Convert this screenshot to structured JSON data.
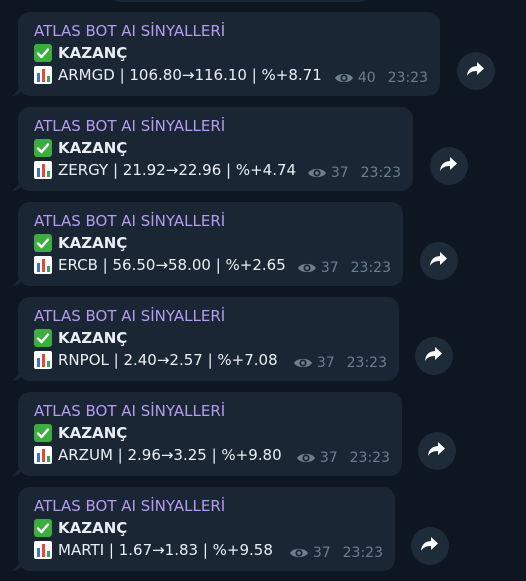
{
  "colors": {
    "background": "#0e1621",
    "bubble": "#1a2633",
    "sender": "#b59cf0",
    "text": "#e9eef3",
    "meta": "#6d7f8f",
    "check": "#3cae3f"
  },
  "messages": [
    {
      "sender": "ATLAS BOT AI SİNYALLERİ",
      "status_icon": "check-mark-icon",
      "status": "KAZANÇ",
      "chart_icon": "bar-chart-icon",
      "trade": "ARMGD | 106.80→116.10 | %+8.71",
      "views": "40",
      "time": "23:23"
    },
    {
      "sender": "ATLAS BOT AI SİNYALLERİ",
      "status_icon": "check-mark-icon",
      "status": "KAZANÇ",
      "chart_icon": "bar-chart-icon",
      "trade": "ZERGY | 21.92→22.96 | %+4.74",
      "views": "37",
      "time": "23:23"
    },
    {
      "sender": "ATLAS BOT AI SİNYALLERİ",
      "status_icon": "check-mark-icon",
      "status": "KAZANÇ",
      "chart_icon": "bar-chart-icon",
      "trade": "ERCB | 56.50→58.00 | %+2.65",
      "views": "37",
      "time": "23:23"
    },
    {
      "sender": "ATLAS BOT AI SİNYALLERİ",
      "status_icon": "check-mark-icon",
      "status": "KAZANÇ",
      "chart_icon": "bar-chart-icon",
      "trade": "RNPOL | 2.40→2.57 | %+7.08",
      "views": "37",
      "time": "23:23"
    },
    {
      "sender": "ATLAS BOT AI SİNYALLERİ",
      "status_icon": "check-mark-icon",
      "status": "KAZANÇ",
      "chart_icon": "bar-chart-icon",
      "trade": "ARZUM | 2.96→3.25 | %+9.80",
      "views": "37",
      "time": "23:23"
    },
    {
      "sender": "ATLAS BOT AI SİNYALLERİ",
      "status_icon": "check-mark-icon",
      "status": "KAZANÇ",
      "chart_icon": "bar-chart-icon",
      "trade": "MARTI | 1.67→1.83 | %+9.58",
      "views": "37",
      "time": "23:23"
    }
  ]
}
